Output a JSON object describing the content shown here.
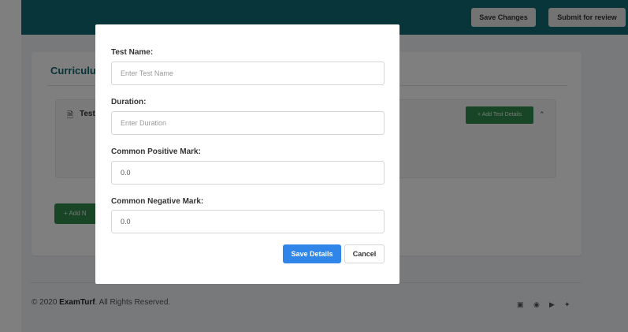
{
  "topbar": {
    "save_changes": "Save Changes",
    "submit_review": "Submit for review"
  },
  "card": {
    "title": "Curriculu",
    "panel_label": "Test",
    "add_test_details": "+ Add Test Details",
    "add_new": "+ Add N"
  },
  "footer": {
    "copyright_prefix": "© 2020 ",
    "brand": "ExamTurf",
    "copyright_suffix": ". All Rights Reserved.",
    "social": [
      "facebook-icon",
      "dribbble-icon",
      "youtube-icon",
      "twitter-icon"
    ]
  },
  "modal": {
    "test_name_label": "Test Name:",
    "test_name_placeholder": "Enter Test Name",
    "duration_label": "Duration:",
    "duration_placeholder": "Enter Duration",
    "positive_label": "Common Positive Mark:",
    "positive_value": "0.0",
    "negative_label": "Common Negative Mark:",
    "negative_value": "0.0",
    "save_label": "Save Details",
    "cancel_label": "Cancel"
  },
  "colors": {
    "topbar": "#0f6b72",
    "primary": "#2f86e8",
    "success": "#2f8a4a"
  }
}
